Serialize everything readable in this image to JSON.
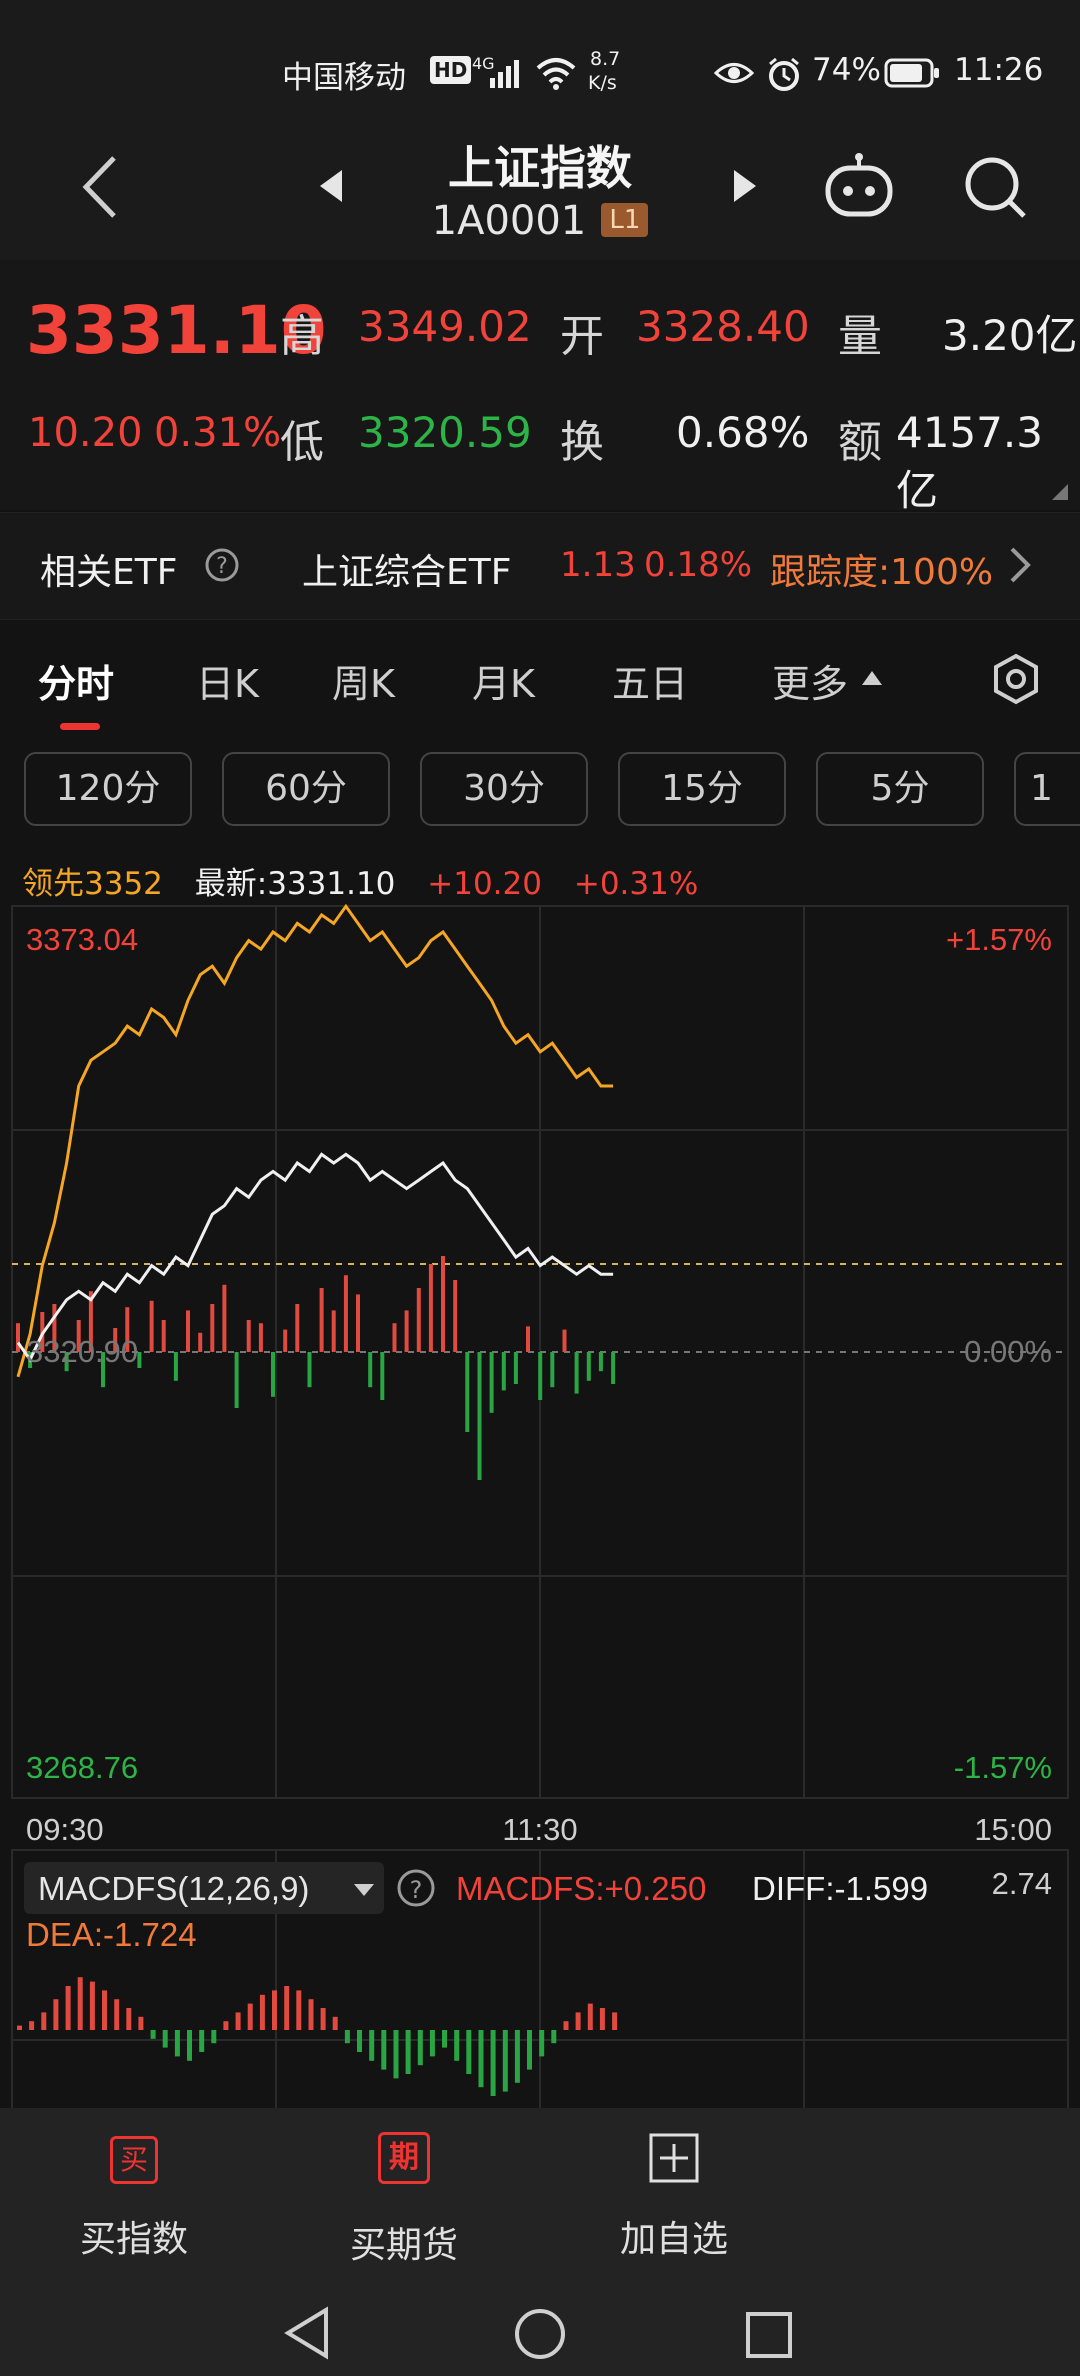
{
  "status_bar": {
    "carrier": "中国移动",
    "hd": "HD",
    "net": "4G",
    "speed_top": "8.7",
    "speed_bottom": "K/s",
    "battery": "74%",
    "time": "11:26"
  },
  "header": {
    "title": "上证指数",
    "code": "1A0001",
    "level_badge": "L1"
  },
  "quote": {
    "price": "3331.10",
    "change": "10.20",
    "change_pct": "0.31%",
    "high_label": "高",
    "high": "3349.02",
    "low_label": "低",
    "low": "3320.59",
    "open_label": "开",
    "open": "3328.40",
    "turnover_label": "换",
    "turnover": "0.68%",
    "volume_label": "量",
    "volume": "3.20亿",
    "amount_label": "额",
    "amount": "4157.3亿"
  },
  "etf": {
    "label": "相关ETF",
    "name": "上证综合ETF",
    "price": "1.13",
    "pct": "0.18%",
    "tracking": "跟踪度:100%"
  },
  "tabs": [
    "分时",
    "日K",
    "周K",
    "月K",
    "五日",
    "更多"
  ],
  "periods": [
    "120分",
    "60分",
    "30分",
    "15分",
    "5分",
    "1"
  ],
  "legend": {
    "lead": "领先3352",
    "latest": "最新:3331.10",
    "chg": "+10.20",
    "pct": "+0.31%"
  },
  "chart_data": {
    "type": "line",
    "y_max": "3373.04",
    "y_min": "3268.76",
    "y_base": "3320.90",
    "pct_max": "+1.57%",
    "pct_zero": "0.00%",
    "pct_min": "-1.57%",
    "x_ticks": [
      "09:30",
      "11:30",
      "15:00"
    ],
    "ylim": [
      3268.76,
      3373.04
    ],
    "series": [
      {
        "name": "领先",
        "color": "#f5a623",
        "values": [
          3318,
          3323,
          3331,
          3336,
          3343,
          3352,
          3355,
          3356,
          3357,
          3359,
          3358,
          3361,
          3360,
          3358,
          3362,
          3365,
          3366,
          3364,
          3367,
          3369,
          3368,
          3370,
          3369,
          3371,
          3370,
          3372,
          3371,
          3373,
          3371,
          3369,
          3370,
          3368,
          3366,
          3367,
          3369,
          3370,
          3368,
          3366,
          3364,
          3362,
          3359,
          3357,
          3358,
          3356,
          3357,
          3355,
          3353,
          3354,
          3352,
          3352
        ]
      },
      {
        "name": "最新",
        "color": "#f0f0f0",
        "values": [
          3322,
          3320,
          3323,
          3325,
          3327,
          3328,
          3327,
          3329,
          3328,
          3330,
          3329,
          3331,
          3330,
          3332,
          3331,
          3334,
          3337,
          3338,
          3340,
          3339,
          3341,
          3342,
          3341,
          3343,
          3342,
          3344,
          3343,
          3344,
          3343,
          3341,
          3342,
          3341,
          3340,
          3341,
          3342,
          3343,
          3341,
          3340,
          3338,
          3336,
          3334,
          3332,
          3333,
          3331,
          3332,
          3331,
          3330,
          3331,
          3330,
          3330
        ]
      }
    ],
    "volume_bars": [
      18,
      10,
      25,
      30,
      12,
      20,
      38,
      22,
      15,
      28,
      10,
      32,
      20,
      18,
      26,
      12,
      30,
      42,
      35,
      20,
      18,
      28,
      14,
      30,
      22,
      40,
      26,
      48,
      36,
      22,
      30,
      18,
      26,
      40,
      55,
      60,
      45,
      50,
      80,
      38,
      24,
      20,
      16,
      30,
      22,
      14,
      26,
      18,
      12,
      20
    ],
    "volume_dir": [
      1,
      -1,
      1,
      1,
      -1,
      1,
      1,
      -1,
      1,
      1,
      -1,
      1,
      1,
      -1,
      1,
      1,
      1,
      1,
      -1,
      1,
      1,
      -1,
      1,
      1,
      -1,
      1,
      1,
      1,
      1,
      -1,
      -1,
      1,
      1,
      1,
      1,
      1,
      1,
      -1,
      -1,
      -1,
      -1,
      -1,
      1,
      -1,
      -1,
      1,
      -1,
      -1,
      -1,
      -1
    ]
  },
  "macd": {
    "name": "MACDFS(12,26,9)",
    "macdfs": "MACDFS:+0.250",
    "diff": "DIFF:-1.599",
    "dea": "DEA:-1.724",
    "scale": "2.74",
    "bars": [
      2,
      4,
      8,
      14,
      20,
      24,
      22,
      18,
      14,
      10,
      6,
      -4,
      -8,
      -12,
      -14,
      -10,
      -6,
      4,
      8,
      12,
      16,
      18,
      20,
      18,
      14,
      10,
      6,
      -6,
      -10,
      -14,
      -18,
      -22,
      -20,
      -16,
      -12,
      -8,
      -14,
      -20,
      -26,
      -30,
      -28,
      -24,
      -18,
      -12,
      -6,
      4,
      8,
      12,
      10,
      8
    ]
  },
  "bottom_nav": {
    "buy_index": "买指数",
    "buy_index_icon": "买",
    "buy_futures": "买期货",
    "buy_futures_icon": "期",
    "add_watch": "加自选"
  }
}
